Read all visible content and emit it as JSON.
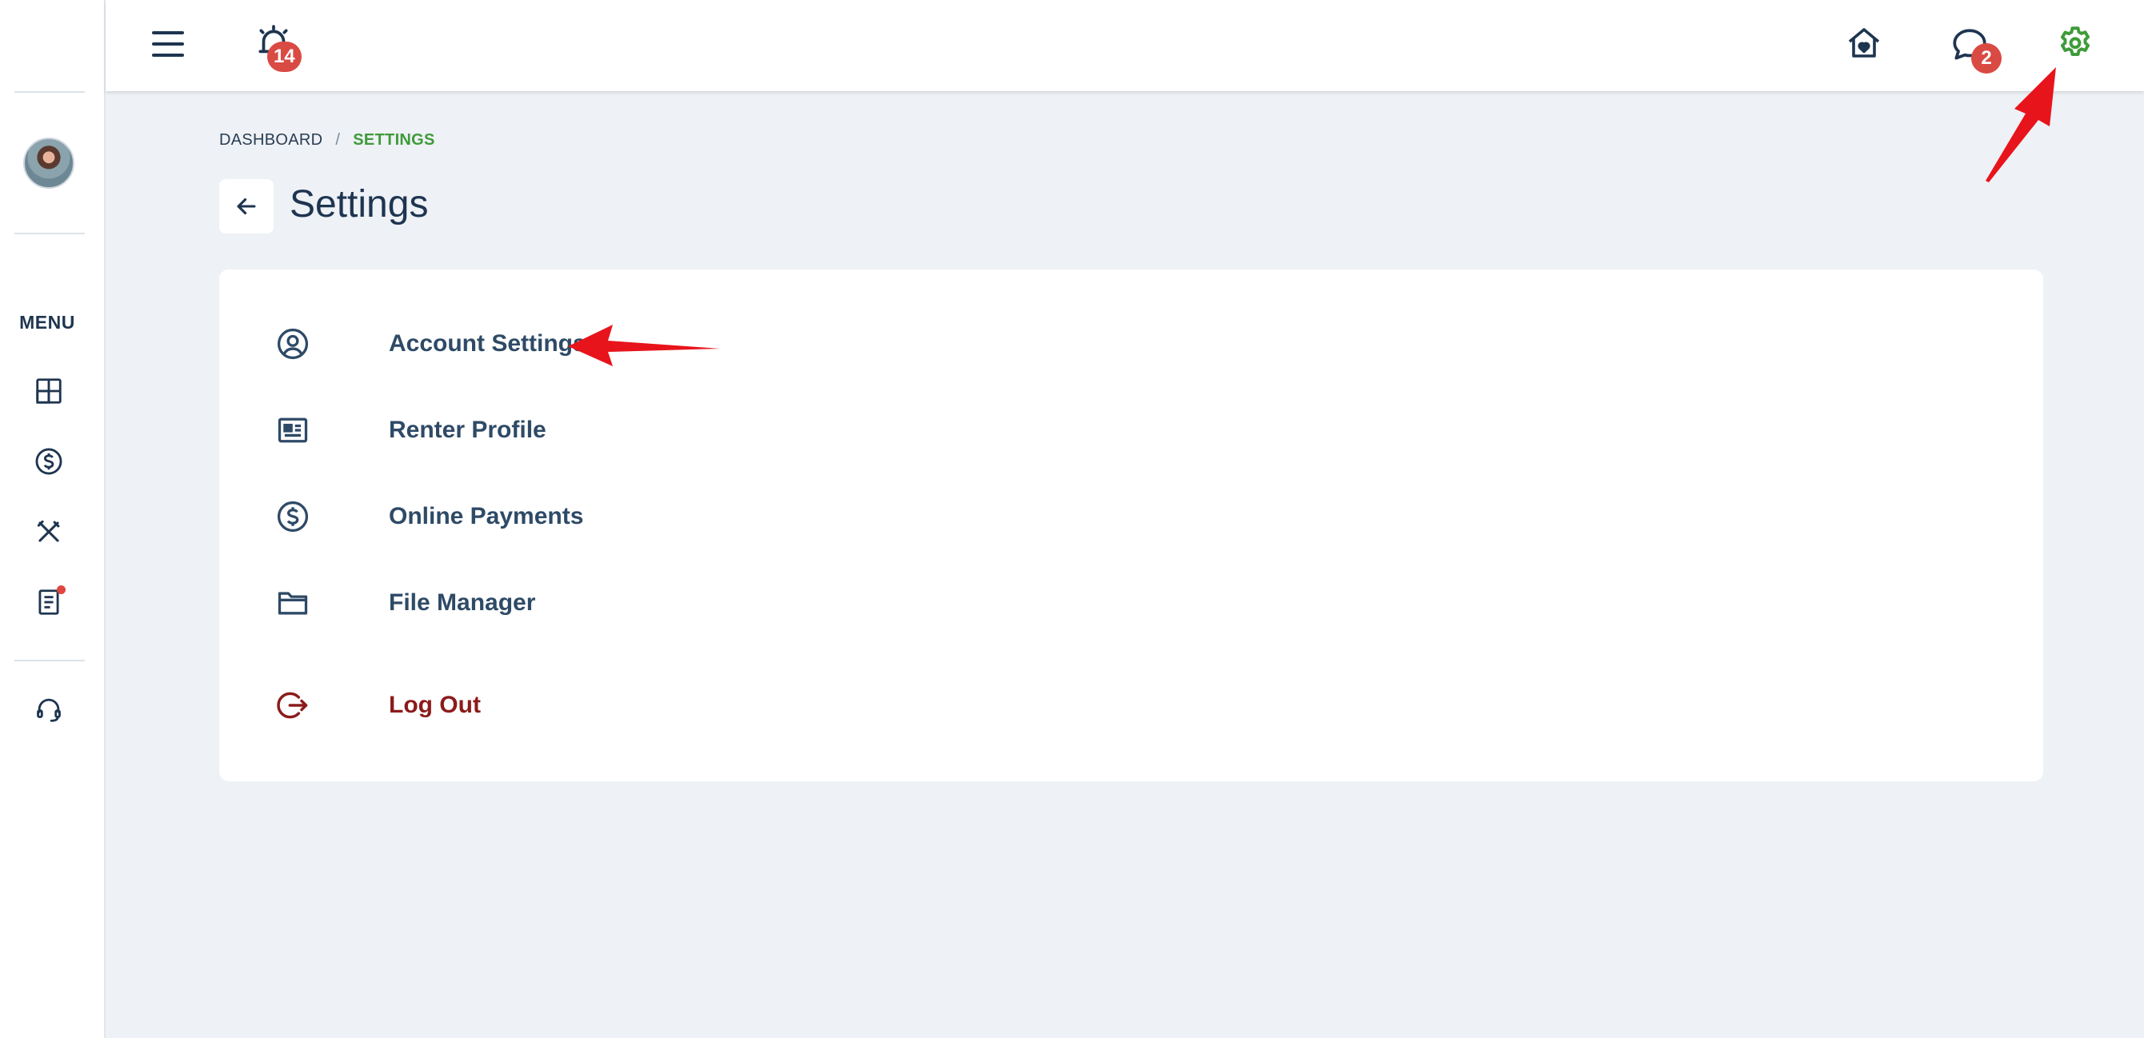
{
  "colors": {
    "accent_green": "#3f9b3a",
    "badge_red": "#d94a43",
    "logout_red": "#8c1b1b",
    "text_navy": "#1e3550",
    "annotation_red": "#e8141b"
  },
  "sidebar": {
    "avatar": "user-avatar",
    "menu_label": "MENU",
    "items": [
      {
        "icon": "dashboard-icon"
      },
      {
        "icon": "dollar-icon"
      },
      {
        "icon": "tools-icon"
      },
      {
        "icon": "document-icon",
        "has_dot": true
      },
      {
        "icon": "headset-icon"
      }
    ]
  },
  "topbar": {
    "menu_icon": "hamburger-icon",
    "notifications": {
      "icon": "alarm-bell-icon",
      "count": "14"
    },
    "home_icon": "home-heart-icon",
    "messages": {
      "icon": "chat-icon",
      "count": "2"
    },
    "settings_icon": "gear-icon"
  },
  "breadcrumb": {
    "parent": "DASHBOARD",
    "separator": "/",
    "current": "SETTINGS"
  },
  "page": {
    "back_icon": "arrow-left-icon",
    "title": "Settings"
  },
  "settings_menu": {
    "items": [
      {
        "label": "Account Settings",
        "icon": "user-circle-icon"
      },
      {
        "label": "Renter Profile",
        "icon": "id-card-icon"
      },
      {
        "label": "Online Payments",
        "icon": "dollar-icon"
      },
      {
        "label": "File Manager",
        "icon": "folder-icon"
      },
      {
        "label": "Log Out",
        "icon": "logout-icon"
      }
    ]
  }
}
